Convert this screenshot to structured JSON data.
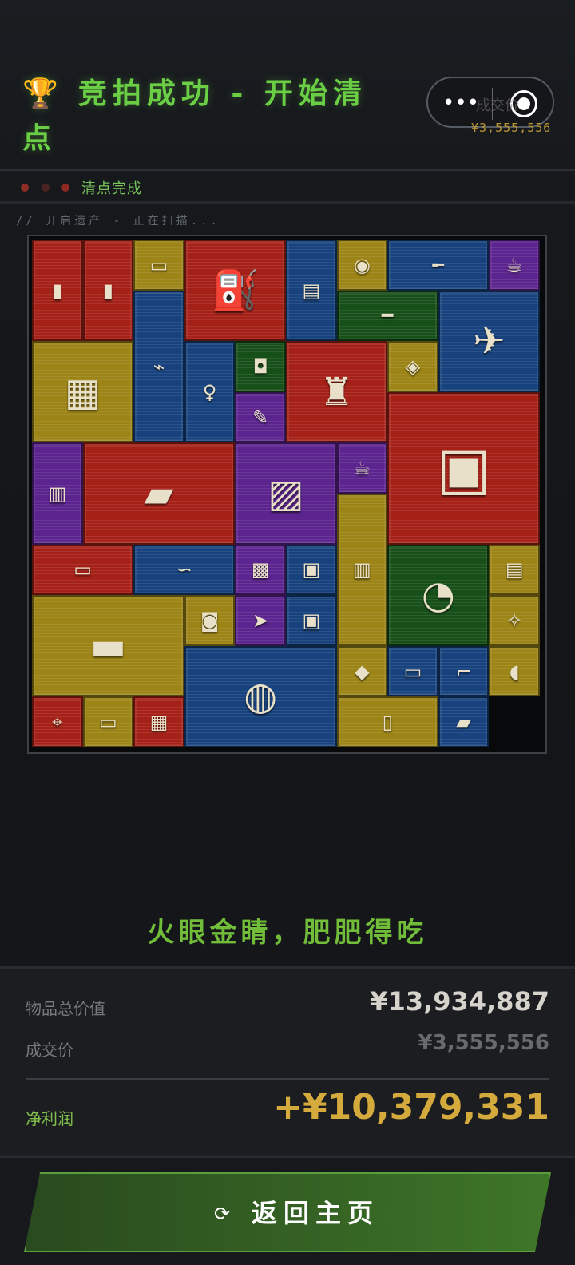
{
  "header": {
    "title": "竞拍成功 - 开始清点",
    "trophy_icon": "🏆",
    "capsule_label": "成交价",
    "capsule_price": "¥3,555,556",
    "capsule_menu_icon": "more-dots-icon",
    "capsule_target_icon": "target-icon"
  },
  "status": {
    "text": "清点完成",
    "scan_text": "// 开启遗产 - 正在扫描...",
    "dots": [
      "#8e2d26",
      "#4b2421",
      "#8c2a23"
    ]
  },
  "items": [
    {
      "name": "gold-bar-1",
      "icon": "▮",
      "color": "red"
    },
    {
      "name": "gold-bar-2",
      "icon": "▮",
      "color": "red"
    },
    {
      "name": "lighter",
      "icon": "▭",
      "color": "yellow"
    },
    {
      "name": "gas-canister",
      "icon": "⛽",
      "color": "red"
    },
    {
      "name": "ammo-jar",
      "icon": "▤",
      "color": "blue"
    },
    {
      "name": "hard-drive",
      "icon": "◉",
      "color": "yellow"
    },
    {
      "name": "rifle",
      "icon": "╾",
      "color": "blue"
    },
    {
      "name": "teacup",
      "icon": "☕",
      "color": "purple"
    },
    {
      "name": "tube",
      "icon": "━",
      "color": "green"
    },
    {
      "name": "drone",
      "icon": "✈",
      "color": "blue"
    },
    {
      "name": "document-bag",
      "icon": "▦",
      "color": "yellow"
    },
    {
      "name": "microscope",
      "icon": "⌁",
      "color": "blue"
    },
    {
      "name": "statue",
      "icon": "♀",
      "color": "blue"
    },
    {
      "name": "jar",
      "icon": "◘",
      "color": "green"
    },
    {
      "name": "golden-crocodile",
      "icon": "♜",
      "color": "red"
    },
    {
      "name": "ring",
      "icon": "◈",
      "color": "yellow"
    },
    {
      "name": "medical-monitor",
      "icon": "▣",
      "color": "red"
    },
    {
      "name": "pen",
      "icon": "✎",
      "color": "purple"
    },
    {
      "name": "card-pack",
      "icon": "▥",
      "color": "purple"
    },
    {
      "name": "armored-vehicle",
      "icon": "▰",
      "color": "red"
    },
    {
      "name": "cassette",
      "icon": "▨",
      "color": "purple"
    },
    {
      "name": "small-teacup",
      "icon": "☕",
      "color": "purple"
    },
    {
      "name": "tablet",
      "icon": "▭",
      "color": "red"
    },
    {
      "name": "pipe",
      "icon": "∽",
      "color": "blue"
    },
    {
      "name": "circuit-board",
      "icon": "▩",
      "color": "purple"
    },
    {
      "name": "cube",
      "icon": "▣",
      "color": "blue"
    },
    {
      "name": "glass-cylinder",
      "icon": "▥",
      "color": "yellow"
    },
    {
      "name": "gauge",
      "icon": "◔",
      "color": "green"
    },
    {
      "name": "radio-station",
      "icon": "▤",
      "color": "yellow"
    },
    {
      "name": "sardine-tin",
      "icon": "▬",
      "color": "yellow"
    },
    {
      "name": "camera",
      "icon": "◙",
      "color": "yellow"
    },
    {
      "name": "arrowhead",
      "icon": "➤",
      "color": "purple"
    },
    {
      "name": "adapter",
      "icon": "▣",
      "color": "blue"
    },
    {
      "name": "necklace",
      "icon": "✧",
      "color": "yellow"
    },
    {
      "name": "pill-bottle",
      "icon": "◍",
      "color": "blue"
    },
    {
      "name": "device",
      "icon": "◆",
      "color": "yellow"
    },
    {
      "name": "gum-pack",
      "icon": "▭",
      "color": "blue"
    },
    {
      "name": "thermometer",
      "icon": "⌐",
      "color": "blue"
    },
    {
      "name": "oximeter",
      "icon": "◖",
      "color": "yellow"
    },
    {
      "name": "compass",
      "icon": "⌖",
      "color": "red"
    },
    {
      "name": "small-lighter",
      "icon": "▭",
      "color": "yellow"
    },
    {
      "name": "graphics-card",
      "icon": "▦",
      "color": "red"
    },
    {
      "name": "phone",
      "icon": "▯",
      "color": "yellow"
    },
    {
      "name": "flashlight",
      "icon": "▰",
      "color": "blue"
    }
  ],
  "slogan": "火眼金睛，肥肥得吃",
  "summary": {
    "total_label": "物品总价值",
    "total_value": "¥13,934,887",
    "deal_label": "成交价",
    "deal_value": "¥3,555,556",
    "profit_label": "净利润",
    "profit_value": "+¥10,379,331"
  },
  "button": {
    "icon": "⟳",
    "label": "返回主页"
  },
  "colors": {
    "accent_green": "#6bcf45",
    "profit_gold": "#d4aa3c",
    "red_cell": "#a52118",
    "yellow_cell": "#9c8416",
    "blue_cell": "#17427d",
    "green_cell": "#174f18",
    "purple_cell": "#5c248f"
  }
}
